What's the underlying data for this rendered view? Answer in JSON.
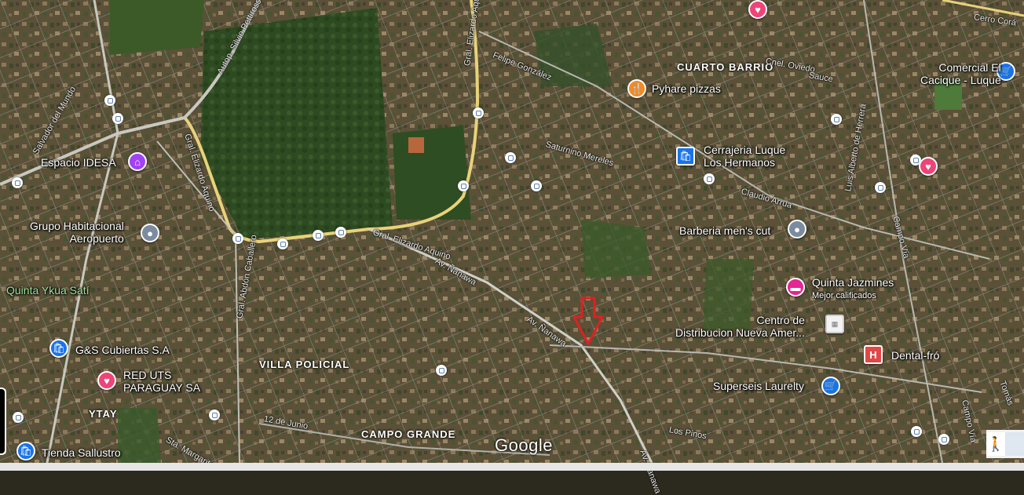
{
  "map": {
    "provider_logo": "Google",
    "areas": [
      "CUARTO BARRIO",
      "VILLA POLICIAL",
      "YTAY",
      "CAMPO GRANDE"
    ],
    "streets": [
      "Autop. Silvio Pettirossi",
      "Gral. Elizardo Aquino",
      "Gral. Elizardo Aquino",
      "Gral. Elizardo Aquino",
      "Felipe González",
      "Cnel. Oviedo",
      "Sauce",
      "Cerro Corá",
      "Saturnino Mereles",
      "Claudio Arrua",
      "Luis Alberto de Herrera",
      "Campo Vía",
      "Av. Ñanawa",
      "Av. Ñanawa",
      "Av. Ñanawa",
      "Gral. Abdón Caballero",
      "12 de Junio",
      "Los Pinos",
      "Salvador del Mundo",
      "Sta. Margarita",
      "Campo Vía",
      "Tomás"
    ],
    "places": [
      {
        "name": "Pyhare pizzas",
        "icon": "fork-knife-icon",
        "color": "#f28b24"
      },
      {
        "name": "Cerrajeria Luque\nLos Hermanos",
        "icon": "shopping-bag-icon",
        "color": "#1a73e8"
      },
      {
        "name": "Comercial El\nCacique - Luque",
        "icon": "shopping-cart-icon",
        "color": "#1a73e8"
      },
      {
        "name": "Espacio IDESA",
        "icon": "store-icon",
        "color": "#a142f4"
      },
      {
        "name": "Grupo Habitacional\nAeropuerto",
        "icon": "pin-icon",
        "color": "#7b8ba0"
      },
      {
        "name": "Barberia men's cut",
        "icon": "pin-icon",
        "color": "#7b8ba0"
      },
      {
        "name": "Quinta Jazmines",
        "sublabel": "Mejor calificados",
        "icon": "bed-icon",
        "color": "#e52592"
      },
      {
        "name": "Quinta Ykua Satí",
        "icon": "",
        "color": "#9ee29a"
      },
      {
        "name": "Centro de\nDistribucion Nueva Amer...",
        "icon": "building-icon",
        "color": "#9e9e9e"
      },
      {
        "name": "G&S Cubiertas S.A",
        "icon": "shopping-bag-icon",
        "color": "#1a73e8"
      },
      {
        "name": "RED UTS\nPARAGUAY SA",
        "icon": "heart-icon",
        "color": "#ee4477"
      },
      {
        "name": "Dental-fró",
        "icon": "hospital-icon",
        "color": "#e04848"
      },
      {
        "name": "Superseis Laurelty",
        "icon": "shopping-cart-icon",
        "color": "#1a73e8"
      },
      {
        "name": "Tienda Sallustro",
        "icon": "shopping-bag-icon",
        "color": "#1a73e8"
      }
    ],
    "marker": {
      "type": "red-arrow",
      "color": "#e02020"
    }
  }
}
